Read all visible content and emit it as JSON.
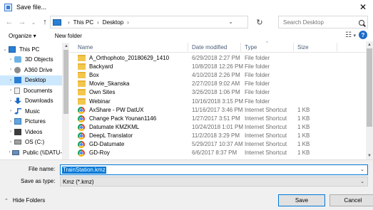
{
  "window": {
    "title": "Save file...",
    "close_glyph": "✕"
  },
  "nav": {
    "back_glyph": "←",
    "forward_glyph": "→",
    "dropdown_glyph": "⌄",
    "up_glyph": "↑",
    "breadcrumb": [
      "This PC",
      "Desktop"
    ],
    "sep_glyph": "›",
    "refresh_glyph": "↻",
    "search_placeholder": "Search Desktop"
  },
  "toolbar": {
    "organize_label": "Organize ▾",
    "new_folder_label": "New folder",
    "view_glyph": "☷",
    "view_caret": "▾",
    "help_glyph": "?"
  },
  "sidebar": {
    "items": [
      {
        "label": "This PC",
        "icon": "pc-icon",
        "arrow": "⌄"
      },
      {
        "label": "3D Objects",
        "icon": "cube-icon",
        "arrow": "›"
      },
      {
        "label": "A360 Drive",
        "icon": "a360-icon",
        "arrow": "›"
      },
      {
        "label": "Desktop",
        "icon": "desktop-icon",
        "arrow": "›",
        "selected": true
      },
      {
        "label": "Documents",
        "icon": "documents-icon",
        "arrow": "›"
      },
      {
        "label": "Downloads",
        "icon": "downloads-icon",
        "arrow": "›"
      },
      {
        "label": "Music",
        "icon": "music-icon",
        "arrow": "›"
      },
      {
        "label": "Pictures",
        "icon": "pictures-icon",
        "arrow": "›"
      },
      {
        "label": "Videos",
        "icon": "videos-icon",
        "arrow": "›"
      },
      {
        "label": "OS (C:)",
        "icon": "drive-icon",
        "arrow": "›"
      },
      {
        "label": "Public (\\\\DATU-",
        "icon": "network-drive-icon",
        "arrow": "›"
      }
    ]
  },
  "columns": {
    "name": "Name",
    "date": "Date modified",
    "type": "Type",
    "size": "Size",
    "sort_glyph": "^"
  },
  "files": [
    {
      "name": "A_Orthophoto_20180629_1410",
      "date": "6/29/2018 2:27 PM",
      "type": "File folder",
      "size": "",
      "kind": "folder"
    },
    {
      "name": "Backyard",
      "date": "10/8/2018 12:26 PM",
      "type": "File folder",
      "size": "",
      "kind": "folder"
    },
    {
      "name": "Box",
      "date": "4/10/2018 2:26 PM",
      "type": "File folder",
      "size": "",
      "kind": "folder"
    },
    {
      "name": "Movie_Skanska",
      "date": "2/27/2018 9:02 AM",
      "type": "File folder",
      "size": "",
      "kind": "folder"
    },
    {
      "name": "Own Sites",
      "date": "3/26/2018 1:06 PM",
      "type": "File folder",
      "size": "",
      "kind": "folder"
    },
    {
      "name": "Webinar",
      "date": "10/16/2018 3:15 PM",
      "type": "File folder",
      "size": "",
      "kind": "folder"
    },
    {
      "name": "AxShare - PW DatUX",
      "date": "11/16/2017 3:46 PM",
      "type": "Internet Shortcut",
      "size": "1 KB",
      "kind": "link"
    },
    {
      "name": "Change Pack Younan1146",
      "date": "1/27/2017 3:51 PM",
      "type": "Internet Shortcut",
      "size": "1 KB",
      "kind": "link"
    },
    {
      "name": "Datumate KMZKML",
      "date": "10/24/2018 1:01 PM",
      "type": "Internet Shortcut",
      "size": "1 KB",
      "kind": "link"
    },
    {
      "name": "DeepL Translator",
      "date": "11/2/2018 3:29 PM",
      "type": "Internet Shortcut",
      "size": "1 KB",
      "kind": "link"
    },
    {
      "name": "GD-Datumate",
      "date": "5/29/2017 10:37 AM",
      "type": "Internet Shortcut",
      "size": "1 KB",
      "kind": "link"
    },
    {
      "name": "GD-Roy",
      "date": "6/6/2017 8:37 PM",
      "type": "Internet Shortcut",
      "size": "1 KB",
      "kind": "link"
    }
  ],
  "bottom": {
    "file_name_label": "File name:",
    "file_name_value": "TrainStation.kmz",
    "save_type_label": "Save as type:",
    "save_type_value": "Kmz (*.kmz)",
    "dropdown_glyph": "⌄",
    "hide_folders_label": "Hide Folders",
    "hide_chevron": "⌃",
    "save_label": "Save",
    "cancel_label": "Cancel"
  },
  "colors": {
    "accent": "#0078d7",
    "folder": "#f3c74e",
    "selected": "#cce8ff"
  }
}
